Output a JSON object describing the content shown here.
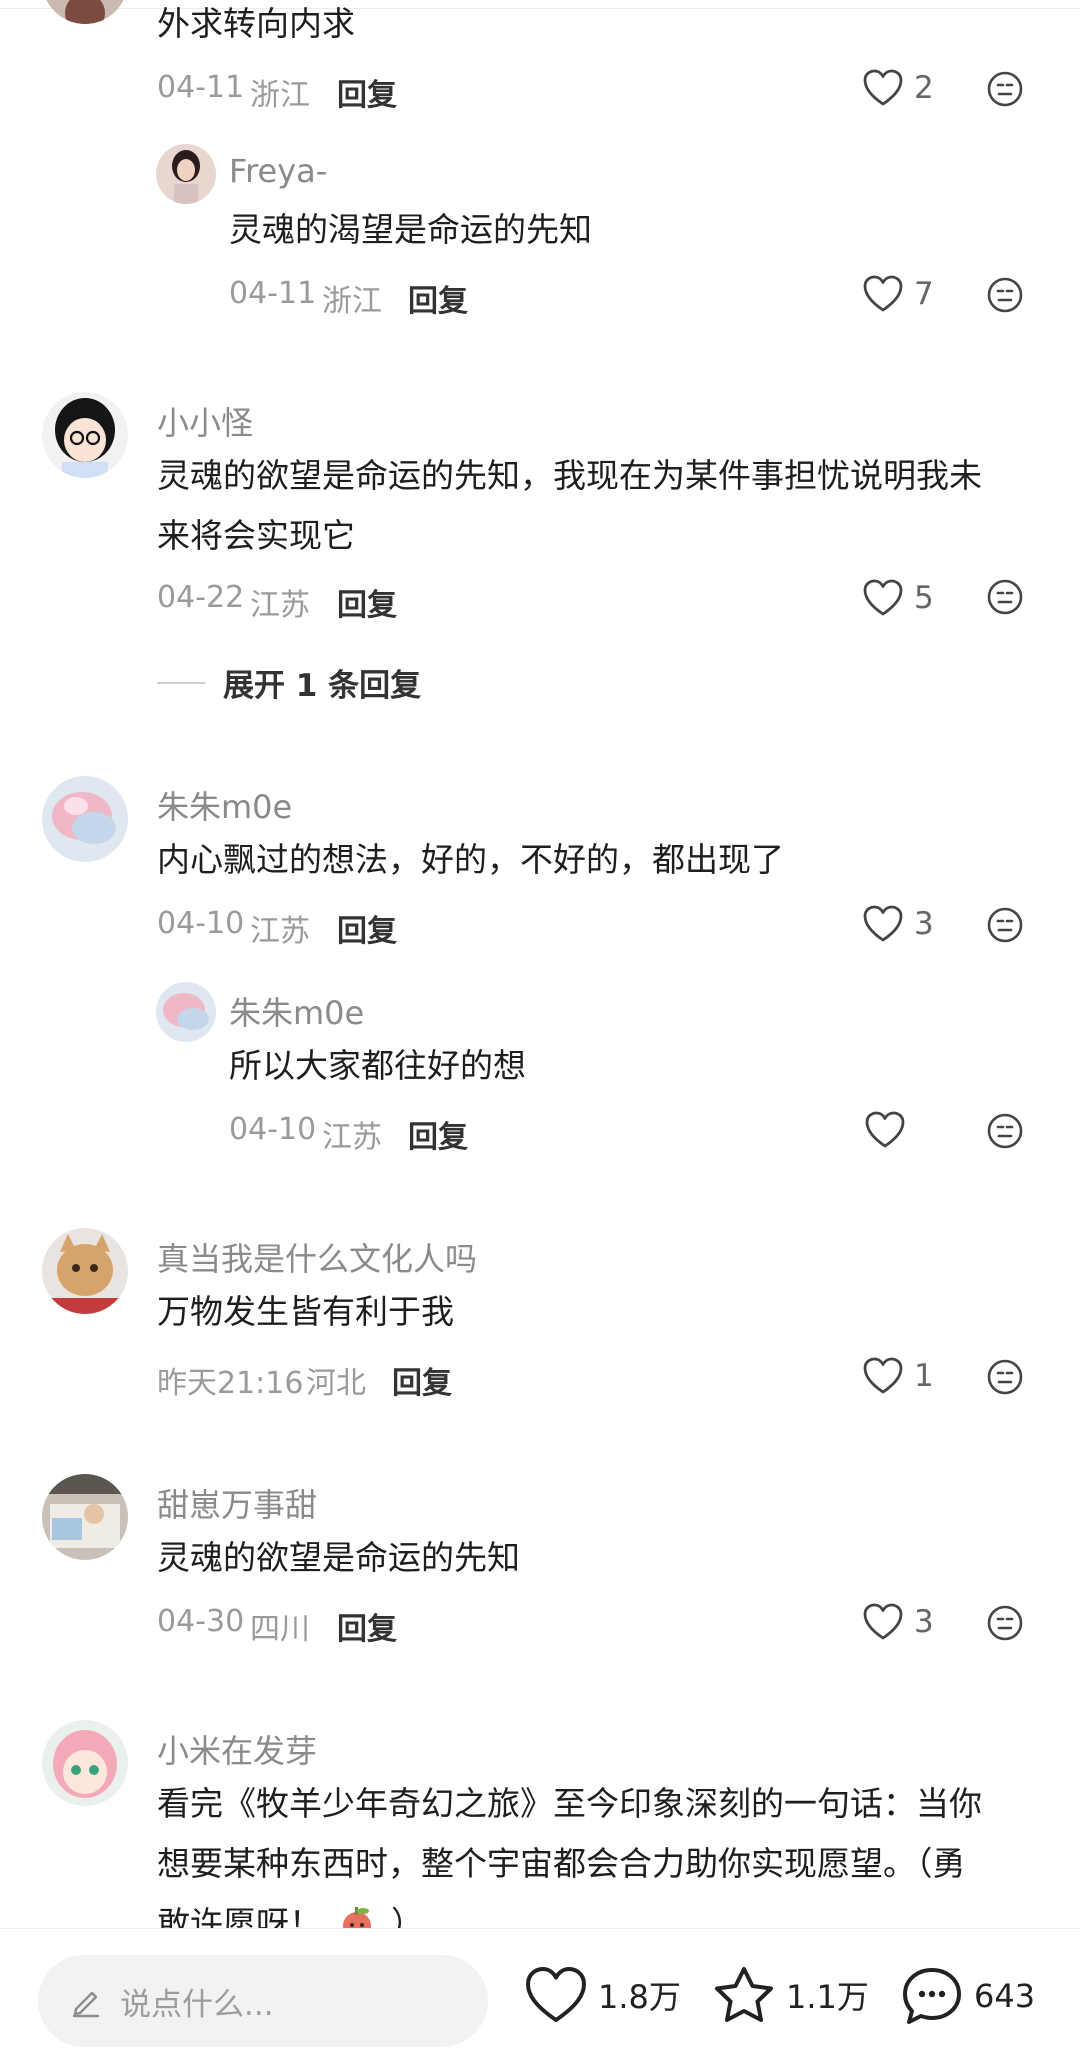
{
  "comments": [
    {
      "text_lines": [
        "外求转向内求"
      ],
      "date": "04-11",
      "location": "浙江",
      "reply_label": "回复",
      "likes": "2",
      "icons": {
        "like": "heart-outline-icon",
        "dislike": "neutral-face-icon"
      }
    },
    {
      "name": "Freya-",
      "text_lines": [
        "灵魂的渴望是命运的先知"
      ],
      "date": "04-11",
      "location": "浙江",
      "reply_label": "回复",
      "likes": "7"
    },
    {
      "name": "小小怪",
      "text_lines": [
        "灵魂的欲望是命运的先知，我现在为某件事担忧说明我未",
        "来将会实现它"
      ],
      "date": "04-22",
      "location": "江苏",
      "reply_label": "回复",
      "likes": "5",
      "expand_label": "展开 1 条回复"
    },
    {
      "name": "朱朱m0e",
      "text_lines": [
        "内心飘过的想法，好的，不好的，都出现了"
      ],
      "date": "04-10",
      "location": "江苏",
      "reply_label": "回复",
      "likes": "3"
    },
    {
      "name": "朱朱m0e",
      "text_lines": [
        "所以大家都往好的想"
      ],
      "date": "04-10",
      "location": "江苏",
      "reply_label": "回复",
      "likes": ""
    },
    {
      "name": "真当我是什么文化人吗",
      "text_lines": [
        "万物发生皆有利于我"
      ],
      "date": "昨天21:16",
      "location": "河北",
      "reply_label": "回复",
      "likes": "1"
    },
    {
      "name": "甜崽万事甜",
      "text_lines": [
        "灵魂的欲望是命运的先知"
      ],
      "date": "04-30",
      "location": "四川",
      "reply_label": "回复",
      "likes": "3"
    },
    {
      "name": "小米在发芽",
      "text_lines": [
        "看完《牧羊少年奇幻之旅》至今印象深刻的一句话：当你",
        "想要某种东西时，整个宇宙都会合力助你实现愿望。（勇",
        "敢许愿呀！"
      ],
      "text_tail": "）",
      "emoji": "apple-emoji-icon"
    }
  ],
  "bottom_bar": {
    "input_placeholder": "说点什么...",
    "likes": "1.8万",
    "favorites": "1.1万",
    "comments": "643",
    "icons": {
      "input": "pencil-icon",
      "like": "heart-icon",
      "favorite": "star-icon",
      "comment": "chat-bubble-icon"
    }
  },
  "colors": {
    "name": "#8a8a8a",
    "meta": "#9a9a9a",
    "text": "#1e1e1e",
    "bar_bg": "#f2f2f2"
  }
}
